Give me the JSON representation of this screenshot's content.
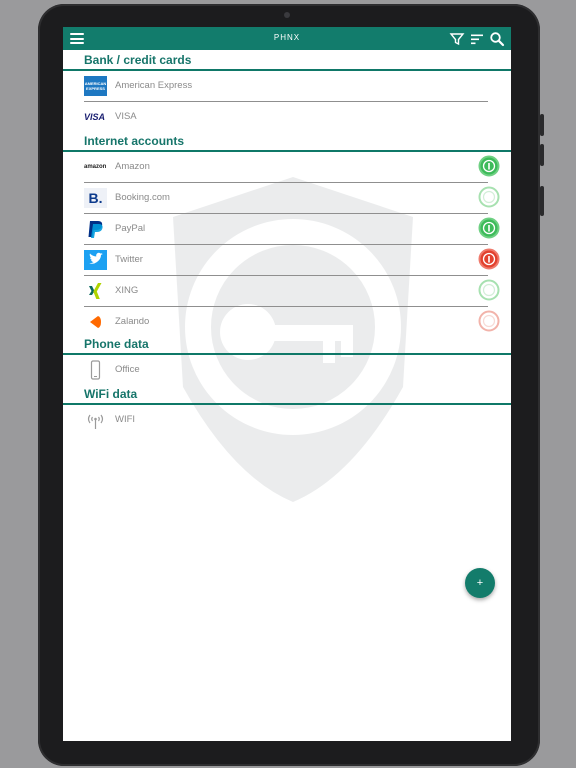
{
  "app": {
    "title": "PHNX"
  },
  "appbar": {
    "menu_icon": "hamburger-menu-icon",
    "filter_icon": "filter-icon",
    "sort_icon": "sort-icon",
    "search_icon": "search-icon"
  },
  "sections": {
    "bank": {
      "title": "Bank / credit cards",
      "items": [
        {
          "label": "American Express",
          "logo": "amex-logo"
        },
        {
          "label": "VISA",
          "logo": "visa-logo"
        }
      ]
    },
    "internet": {
      "title": "Internet accounts",
      "items": [
        {
          "label": "Amazon",
          "logo": "amazon-logo",
          "status": "strong",
          "status_color": "#3dbb5a"
        },
        {
          "label": "Booking.com",
          "logo": "booking-logo",
          "status": "strong-faded",
          "status_color": "#a7e1b0"
        },
        {
          "label": "PayPal",
          "logo": "paypal-logo",
          "status": "strong",
          "status_color": "#3dbb5a"
        },
        {
          "label": "Twitter",
          "logo": "twitter-logo",
          "status": "weak",
          "status_color": "#e2412e"
        },
        {
          "label": "XING",
          "logo": "xing-logo",
          "status": "strong-faded",
          "status_color": "#a7e1b0"
        },
        {
          "label": "Zalando",
          "logo": "zalando-logo",
          "status": "weak-faded",
          "status_color": "#f2b3aa"
        }
      ]
    },
    "phone": {
      "title": "Phone data",
      "items": [
        {
          "label": "Office",
          "logo": "phone-icon"
        }
      ]
    },
    "wifi": {
      "title": "WiFi data",
      "items": [
        {
          "label": "WIFI",
          "logo": "wifi-icon"
        }
      ]
    }
  },
  "fab": {
    "label": "+"
  },
  "logos": {
    "amex": "AMERICAN EXPRESS",
    "visa": "VISA",
    "amazon": "amazon",
    "booking": "B."
  },
  "colors": {
    "accent": "#127c6c",
    "section_text": "#16756a",
    "good": "#3dbb5a",
    "bad": "#e2412e"
  }
}
